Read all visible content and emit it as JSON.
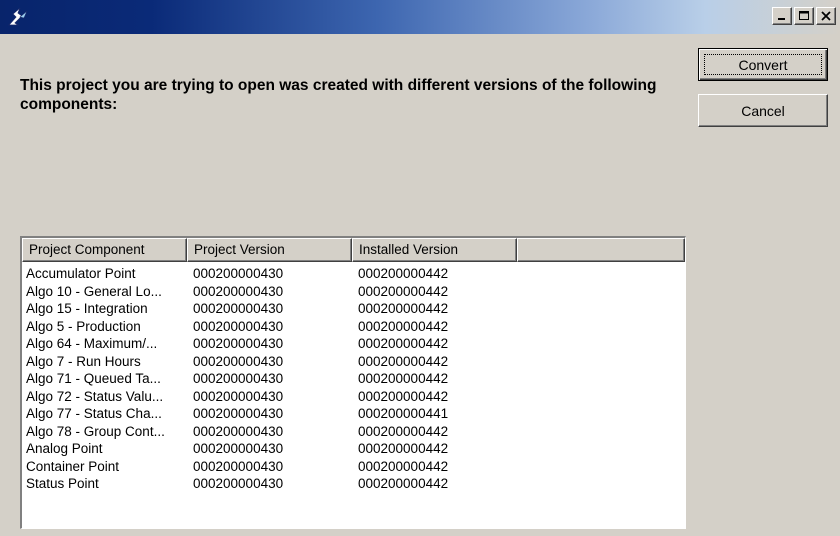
{
  "dialog": {
    "title": "",
    "message": "This project you are trying to open was created with different versions of the following components:",
    "buttons": {
      "convert": "Convert",
      "cancel": "Cancel"
    }
  },
  "table": {
    "columns": [
      "Project Component",
      "Project Version",
      "Installed Version",
      ""
    ],
    "rows": [
      [
        "Accumulator Point",
        "000200000430",
        "000200000442"
      ],
      [
        "Algo 10 - General Lo...",
        "000200000430",
        "000200000442"
      ],
      [
        "Algo 15 - Integration",
        "000200000430",
        "000200000442"
      ],
      [
        "Algo 5 - Production",
        "000200000430",
        "000200000442"
      ],
      [
        "Algo 64 - Maximum/...",
        "000200000430",
        "000200000442"
      ],
      [
        "Algo 7 - Run Hours",
        "000200000430",
        "000200000442"
      ],
      [
        "Algo 71 - Queued Ta...",
        "000200000430",
        "000200000442"
      ],
      [
        "Algo 72 - Status Valu...",
        "000200000430",
        "000200000442"
      ],
      [
        "Algo 77 - Status Cha...",
        "000200000430",
        "000200000441"
      ],
      [
        "Algo 78 - Group Cont...",
        "000200000430",
        "000200000442"
      ],
      [
        "Analog Point",
        "000200000430",
        "000200000442"
      ],
      [
        "Container Point",
        "000200000430",
        "000200000442"
      ],
      [
        "Status Point",
        "000200000430",
        "000200000442"
      ]
    ]
  },
  "icons": {
    "app": "app-icon",
    "minimize": "minimize-icon",
    "maximize": "maximize-icon",
    "close": "close-icon"
  },
  "colors": {
    "titlebar_start": "#08246b",
    "titlebar_end": "#d4d0c8",
    "face": "#d4d0c8"
  }
}
